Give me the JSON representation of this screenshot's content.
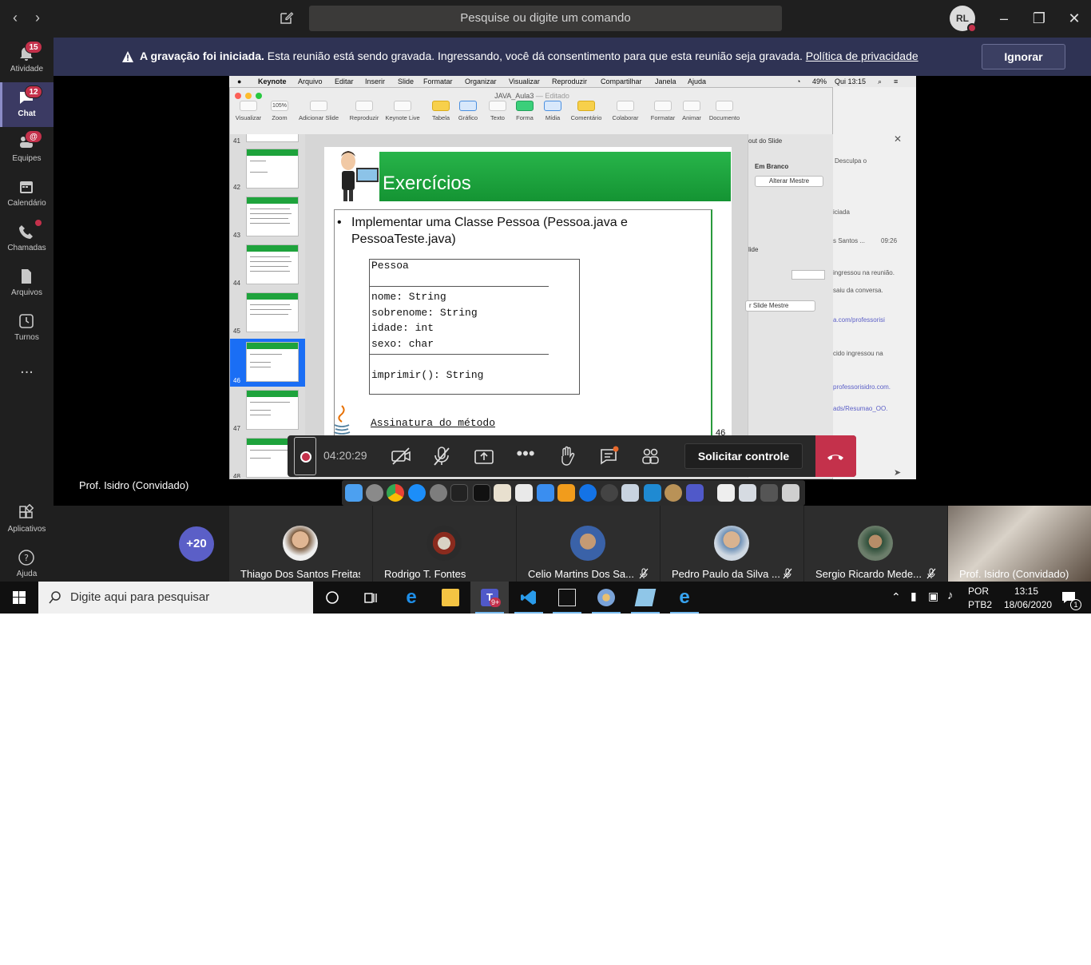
{
  "titlebar": {
    "search_placeholder": "Pesquise ou digite um comando",
    "user_initials": "RL"
  },
  "rail": {
    "items": [
      {
        "label": "Atividade",
        "badge": "15",
        "icon": "bell-icon"
      },
      {
        "label": "Chat",
        "badge": "12",
        "icon": "chat-icon"
      },
      {
        "label": "Equipes",
        "badge": "@",
        "icon": "teams-icon"
      },
      {
        "label": "Calendário",
        "icon": "calendar-icon"
      },
      {
        "label": "Chamadas",
        "icon": "phone-icon"
      },
      {
        "label": "Arquivos",
        "icon": "file-icon"
      },
      {
        "label": "Turnos",
        "icon": "clock-icon"
      }
    ],
    "more": "...",
    "apps": "Aplicativos",
    "help": "Ajuda"
  },
  "banner": {
    "bold": "A gravação foi iniciada.",
    "text": " Esta reunião está sendo gravada. Ingressando, você dá consentimento para que esta reunião seja gravada. ",
    "link": "Política de privacidade",
    "button": "Ignorar"
  },
  "mac": {
    "menubar": [
      "Keynote",
      "Arquivo",
      "Editar",
      "Inserir",
      "Slide",
      "Formatar",
      "Organizar",
      "Visualizar",
      "Reproduzir",
      "Compartilhar",
      "Janela",
      "Ajuda"
    ],
    "battery": "49%",
    "clock": "Qui 13:15",
    "doc_title": "JAVA_Aula3",
    "doc_state": "— Editado",
    "toolbar": [
      "Visualizar",
      "Zoom",
      "Adicionar Slide",
      "Reproduzir",
      "Keynote Live",
      "Tabela",
      "Gráfico",
      "Texto",
      "Forma",
      "Mídia",
      "Comentário",
      "Colaborar",
      "Formatar",
      "Animar",
      "Documento"
    ],
    "zoom": "105%",
    "thumb_numbers": [
      "41",
      "42",
      "43",
      "44",
      "45",
      "46",
      "47",
      "48"
    ],
    "selected_thumb": "46"
  },
  "slide": {
    "title": "Exercícios",
    "bullet": "Implementar uma Classe Pessoa (Pessoa.java e PessoaTeste.java)",
    "uml": {
      "class_name": "Pessoa",
      "attributes": [
        "nome: String",
        "sobrenome: String",
        "idade: int",
        "sexo: char"
      ],
      "methods": [
        "imprimir(): String"
      ]
    },
    "signature_label": "Assinatura do método",
    "page": "46"
  },
  "inspector": {
    "header": "out do Slide",
    "layout": "Em Branco",
    "change_master": "Alterar Mestre",
    "slide_label": "lide",
    "master_slide": "r Slide Mestre"
  },
  "chat_remnant": {
    "lines": [
      "Desculpa o",
      "iciada",
      "s Santos ...",
      "09:26",
      "ingressou na reunião.",
      "saiu da conversa.",
      "a.com/professorisi",
      "cido ingressou na",
      "professorisidro.com.",
      "ads/Resumao_OO."
    ]
  },
  "call": {
    "timer": "04:20:29",
    "request_control": "Solicitar controle",
    "presenter": "Prof. Isidro (Convidado)"
  },
  "participants": {
    "more": "+20",
    "people": [
      {
        "name": "Thiago Dos Santos Freitas",
        "muted": false
      },
      {
        "name": "Rodrigo T. Fontes",
        "muted": false
      },
      {
        "name": "Celio Martins Dos Sa...",
        "muted": true
      },
      {
        "name": "Pedro Paulo da Silva ...",
        "muted": true
      },
      {
        "name": "Sergio Ricardo Mede...",
        "muted": true
      }
    ],
    "self_video_name": "Prof. Isidro (Convidado)"
  },
  "taskbar": {
    "search_placeholder": "Digite aqui para pesquisar",
    "teams_badge": "9+",
    "lang_1": "POR",
    "lang_2": "PTB2",
    "time": "13:15",
    "date": "18/06/2020",
    "notifications": "1"
  },
  "colors": {
    "teams_purple": "#5b5fc7",
    "banner_bg": "#2f3354",
    "hangup_red": "#c4314b",
    "slide_green": "#1ea33c"
  }
}
